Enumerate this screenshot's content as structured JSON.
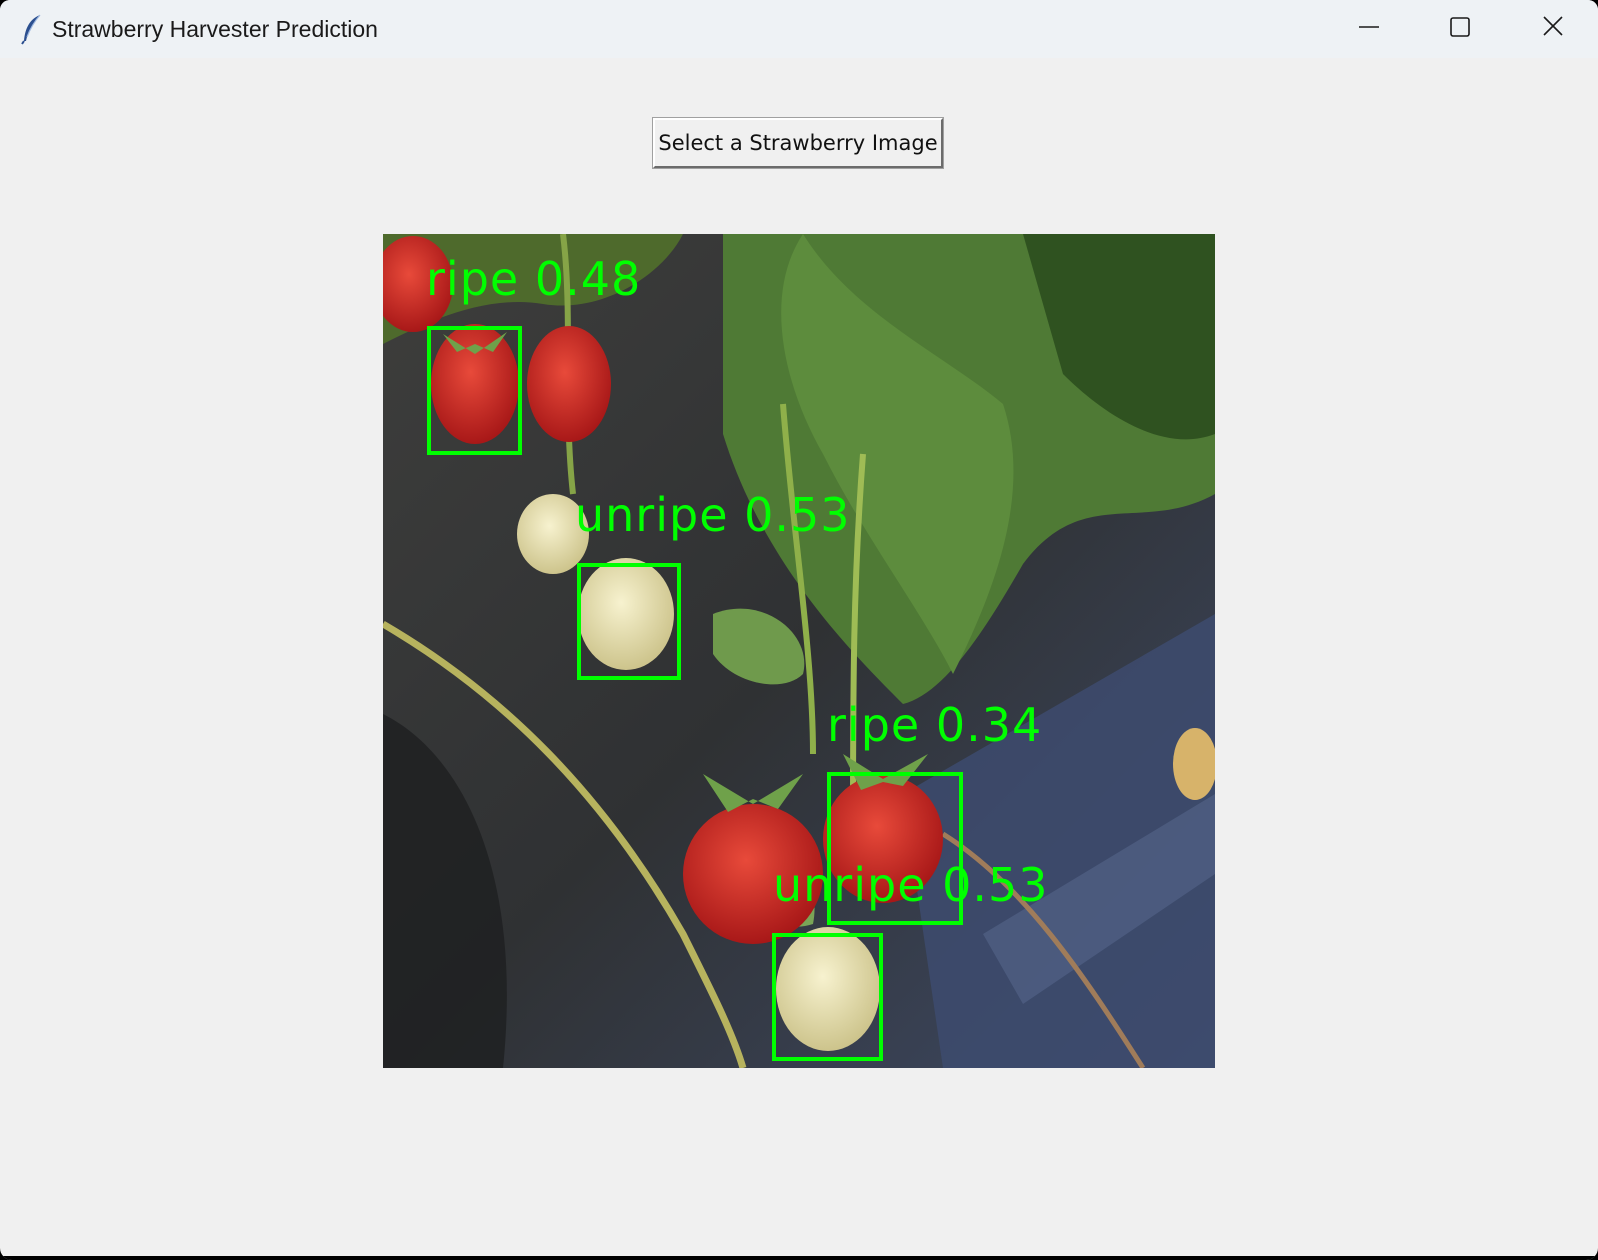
{
  "window": {
    "title": "Strawberry Harvester Prediction",
    "icon": "feather-icon"
  },
  "controls": {
    "minimize_icon": "minimize-icon",
    "maximize_icon": "maximize-icon",
    "close_icon": "close-icon"
  },
  "main": {
    "select_button_label": "Select a Strawberry Image"
  },
  "image": {
    "detections": [
      {
        "label": "ripe 0.48"
      },
      {
        "label": "unripe 0.53"
      },
      {
        "label": "ripe 0.34"
      },
      {
        "label": "unripe 0.53"
      }
    ]
  },
  "colors": {
    "detection": "#00ff00",
    "window_background": "#f0f0f0",
    "titlebar": "#eef2f5"
  }
}
